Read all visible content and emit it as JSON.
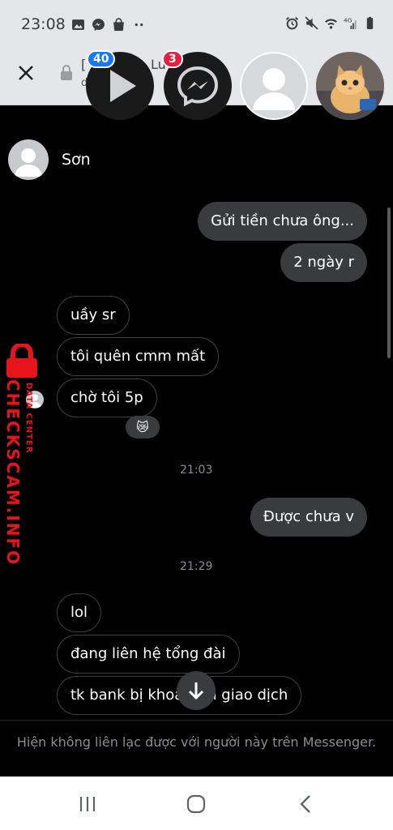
{
  "status_bar": {
    "time": "23:08",
    "left_icons": [
      "image-icon",
      "messenger-icon",
      "shopping-bag-icon",
      "more-dots-icon"
    ],
    "right_icons": [
      "alarm-icon",
      "mute-icon",
      "wifi-icon",
      "signal-4g-icon",
      "battery-icon"
    ]
  },
  "browser": {
    "fragments": [
      "[",
      "Lu",
      "d",
      "in"
    ]
  },
  "chat_heads": {
    "badge_play": "40",
    "badge_messenger": "3"
  },
  "chat": {
    "contact_name": "Sơn",
    "messages": [
      {
        "text": "Gửi tiền chưa ông...",
        "dir": "out"
      },
      {
        "text": "2 ngày r",
        "dir": "out"
      },
      {
        "text": "uầy sr",
        "dir": "in"
      },
      {
        "text": "tôi quên cmm mất",
        "dir": "in"
      },
      {
        "text": "chờ tôi 5p",
        "dir": "in"
      },
      {
        "text": "Được chưa v",
        "dir": "out"
      },
      {
        "text": "lol",
        "dir": "in"
      },
      {
        "text": "đang liên hệ tổng đài",
        "dir": "in"
      },
      {
        "text": "tk bank bị khoá tạm giao dịch",
        "dir": "in"
      }
    ],
    "reaction": "😿",
    "timestamps": [
      "21:03",
      "21:29"
    ],
    "footer_notice": "Hiện không liên lạc được với người này trên Messenger."
  },
  "watermark": {
    "small": "DATA CENTER",
    "big": "CHECKSCAM.INFO"
  },
  "colors": {
    "bubble_out": "#3a3b3c",
    "accent_blue": "#1877f2",
    "badge_red": "#e41e3f",
    "watermark_red": "#e8141c"
  }
}
